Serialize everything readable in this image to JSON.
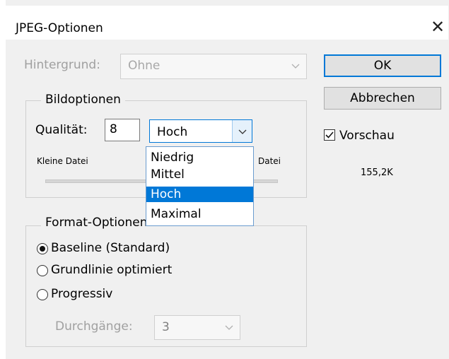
{
  "window": {
    "title": "JPEG-Optionen"
  },
  "background_row": {
    "label": "Hintergrund:",
    "value": "Ohne"
  },
  "image_options": {
    "legend": "Bildoptionen",
    "quality_label": "Qualität:",
    "quality_value": "8",
    "preset_value": "Hoch",
    "small_label": "Kleine Datei",
    "large_label": "Datei",
    "dropdown_options": [
      "Niedrig",
      "Mittel",
      "Hoch",
      "Maximal"
    ]
  },
  "format_options": {
    "legend": "Format-Optionen",
    "options": [
      "Baseline (Standard)",
      "Grundlinie optimiert",
      "Progressiv"
    ],
    "selected": "Baseline (Standard)",
    "passes_label": "Durchgänge:",
    "passes_value": "3"
  },
  "actions": {
    "ok": "OK",
    "cancel": "Abbrechen"
  },
  "preview": {
    "label": "Vorschau",
    "checked": true,
    "size": "155,2K"
  },
  "colors": {
    "accent": "#0078d7",
    "disabled_text": "#a0a0a0"
  }
}
